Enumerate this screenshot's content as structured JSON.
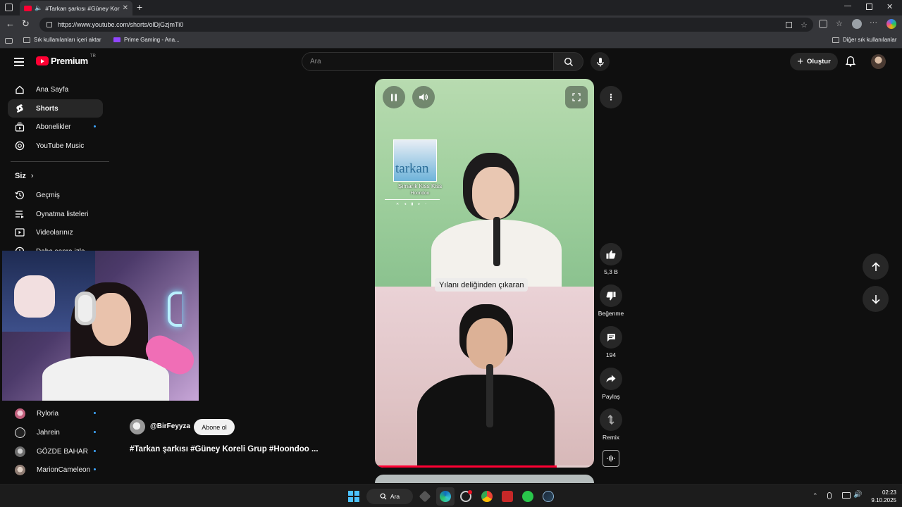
{
  "browser": {
    "tab_title": "#Tarkan şarkısı #Güney Korel",
    "new_tab_icon": "plus-icon",
    "url": "https://www.youtube.com/shorts/olDjGzjmTi0",
    "bookmarks": {
      "import_label": "Sık kullanılanları içeri aktar",
      "prime_label": "Prime Gaming - Ana...",
      "other_label": "Diğer sık kullanılanlar"
    }
  },
  "youtube": {
    "logo_text": "Premium",
    "logo_region": "TR",
    "search_placeholder": "Ara",
    "create_label": "Oluştur",
    "sidebar": {
      "items": [
        {
          "label": "Ana Sayfa",
          "icon": "home-icon"
        },
        {
          "label": "Shorts",
          "icon": "shorts-icon"
        },
        {
          "label": "Abonelikler",
          "icon": "subscriptions-icon"
        },
        {
          "label": "YouTube Music",
          "icon": "music-icon"
        }
      ],
      "you_header": "Siz",
      "you_items": [
        {
          "label": "Geçmiş",
          "icon": "history-icon"
        },
        {
          "label": "Oynatma listeleri",
          "icon": "playlist-icon"
        },
        {
          "label": "Videolarınız",
          "icon": "your-videos-icon"
        },
        {
          "label": "Daha sonra izle",
          "icon": "watch-later-icon"
        }
      ],
      "subscriptions": [
        {
          "label": "Ryloria",
          "color": "#c2607d"
        },
        {
          "label": "Jahrein",
          "color": "#e5e5e5"
        },
        {
          "label": "GÖZDE BAHAR",
          "color": "#8a8a8a"
        },
        {
          "label": "MarionCameleon",
          "color": "#b8a7a0"
        }
      ]
    },
    "short": {
      "channel": "@BirFeyyza",
      "subscribe_label": "Abone ol",
      "title": "#Tarkan şarkısı #Güney Koreli Grup #Hoondoo ...",
      "subtitle_text": "Yılanı deliğinden çıkaran",
      "album_title": "tarkan",
      "album_song": "Şımarık Kiss Kiss",
      "album_artist": "Hoondoo",
      "progress": 0.83,
      "accent": "#ff0033"
    },
    "actions": {
      "likes": "5,3 B",
      "dislike_label": "Beğenme",
      "comments": "194",
      "share_label": "Paylaş",
      "remix_label": "Remix"
    }
  },
  "taskbar": {
    "search_label": "Ara",
    "time": "02:23",
    "date": "9.10.2025"
  }
}
